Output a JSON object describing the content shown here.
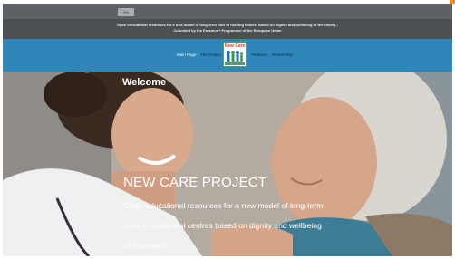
{
  "topbar": {
    "language_label": "EN"
  },
  "tagline": {
    "line1": "Open educational resources for a new model of long-term care of nursing homes, based on dignity and wellbeing of the elderly -",
    "line2": "Cofunded by the Erasmus+ Programme of the European Union"
  },
  "nav": {
    "items": [
      {
        "label": "Main Page"
      },
      {
        "label": "The Project"
      },
      {
        "label": "Products"
      },
      {
        "label": "Partnership"
      }
    ]
  },
  "logo": {
    "text": "New Care"
  },
  "hero": {
    "welcome": "Welcome",
    "title": "NEW CARE PROJECT",
    "subtitle_lines": [
      "Open educational resources for a new model of long-term",
      "care in residential centres based on dignity and wellbeing",
      "of the elderly"
    ]
  },
  "colors": {
    "nav_bg": "#2f86b8",
    "topbar_bg": "#5e6267",
    "tagline_bg": "#4c5055"
  }
}
